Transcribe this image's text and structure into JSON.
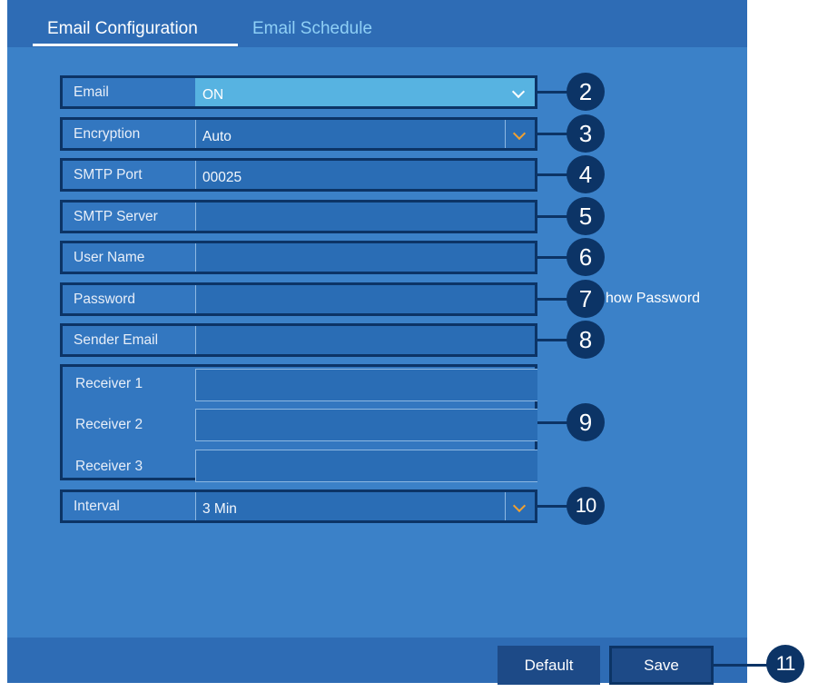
{
  "tabs": [
    {
      "label": "Email Configuration",
      "active": true
    },
    {
      "label": "Email Schedule",
      "active": false
    }
  ],
  "form": {
    "email": {
      "label": "Email",
      "value": "ON"
    },
    "encryption": {
      "label": "Encryption",
      "value": "Auto"
    },
    "smtp_port": {
      "label": "SMTP Port",
      "value": "00025"
    },
    "smtp_server": {
      "label": "SMTP Server",
      "value": ""
    },
    "user_name": {
      "label": "User Name",
      "value": ""
    },
    "password": {
      "label": "Password",
      "value": ""
    },
    "show_password": {
      "label": "how Password"
    },
    "sender_email": {
      "label": "Sender Email",
      "value": ""
    },
    "receivers": [
      {
        "label": "Receiver 1",
        "value": ""
      },
      {
        "label": "Receiver 2",
        "value": ""
      },
      {
        "label": "Receiver 3",
        "value": ""
      }
    ],
    "interval": {
      "label": "Interval",
      "value": "3 Min"
    }
  },
  "buttons": {
    "default": "Default",
    "save": "Save"
  },
  "callouts": [
    "2",
    "3",
    "4",
    "5",
    "6",
    "7",
    "8",
    "9",
    "10",
    "11"
  ],
  "colors": {
    "panel": "#3b81c8",
    "callout": "#0c3466",
    "highlight": "#57b3e1",
    "chevron_accent": "#f0a030"
  },
  "icons": {
    "dropdown": "chevron-down-icon"
  }
}
